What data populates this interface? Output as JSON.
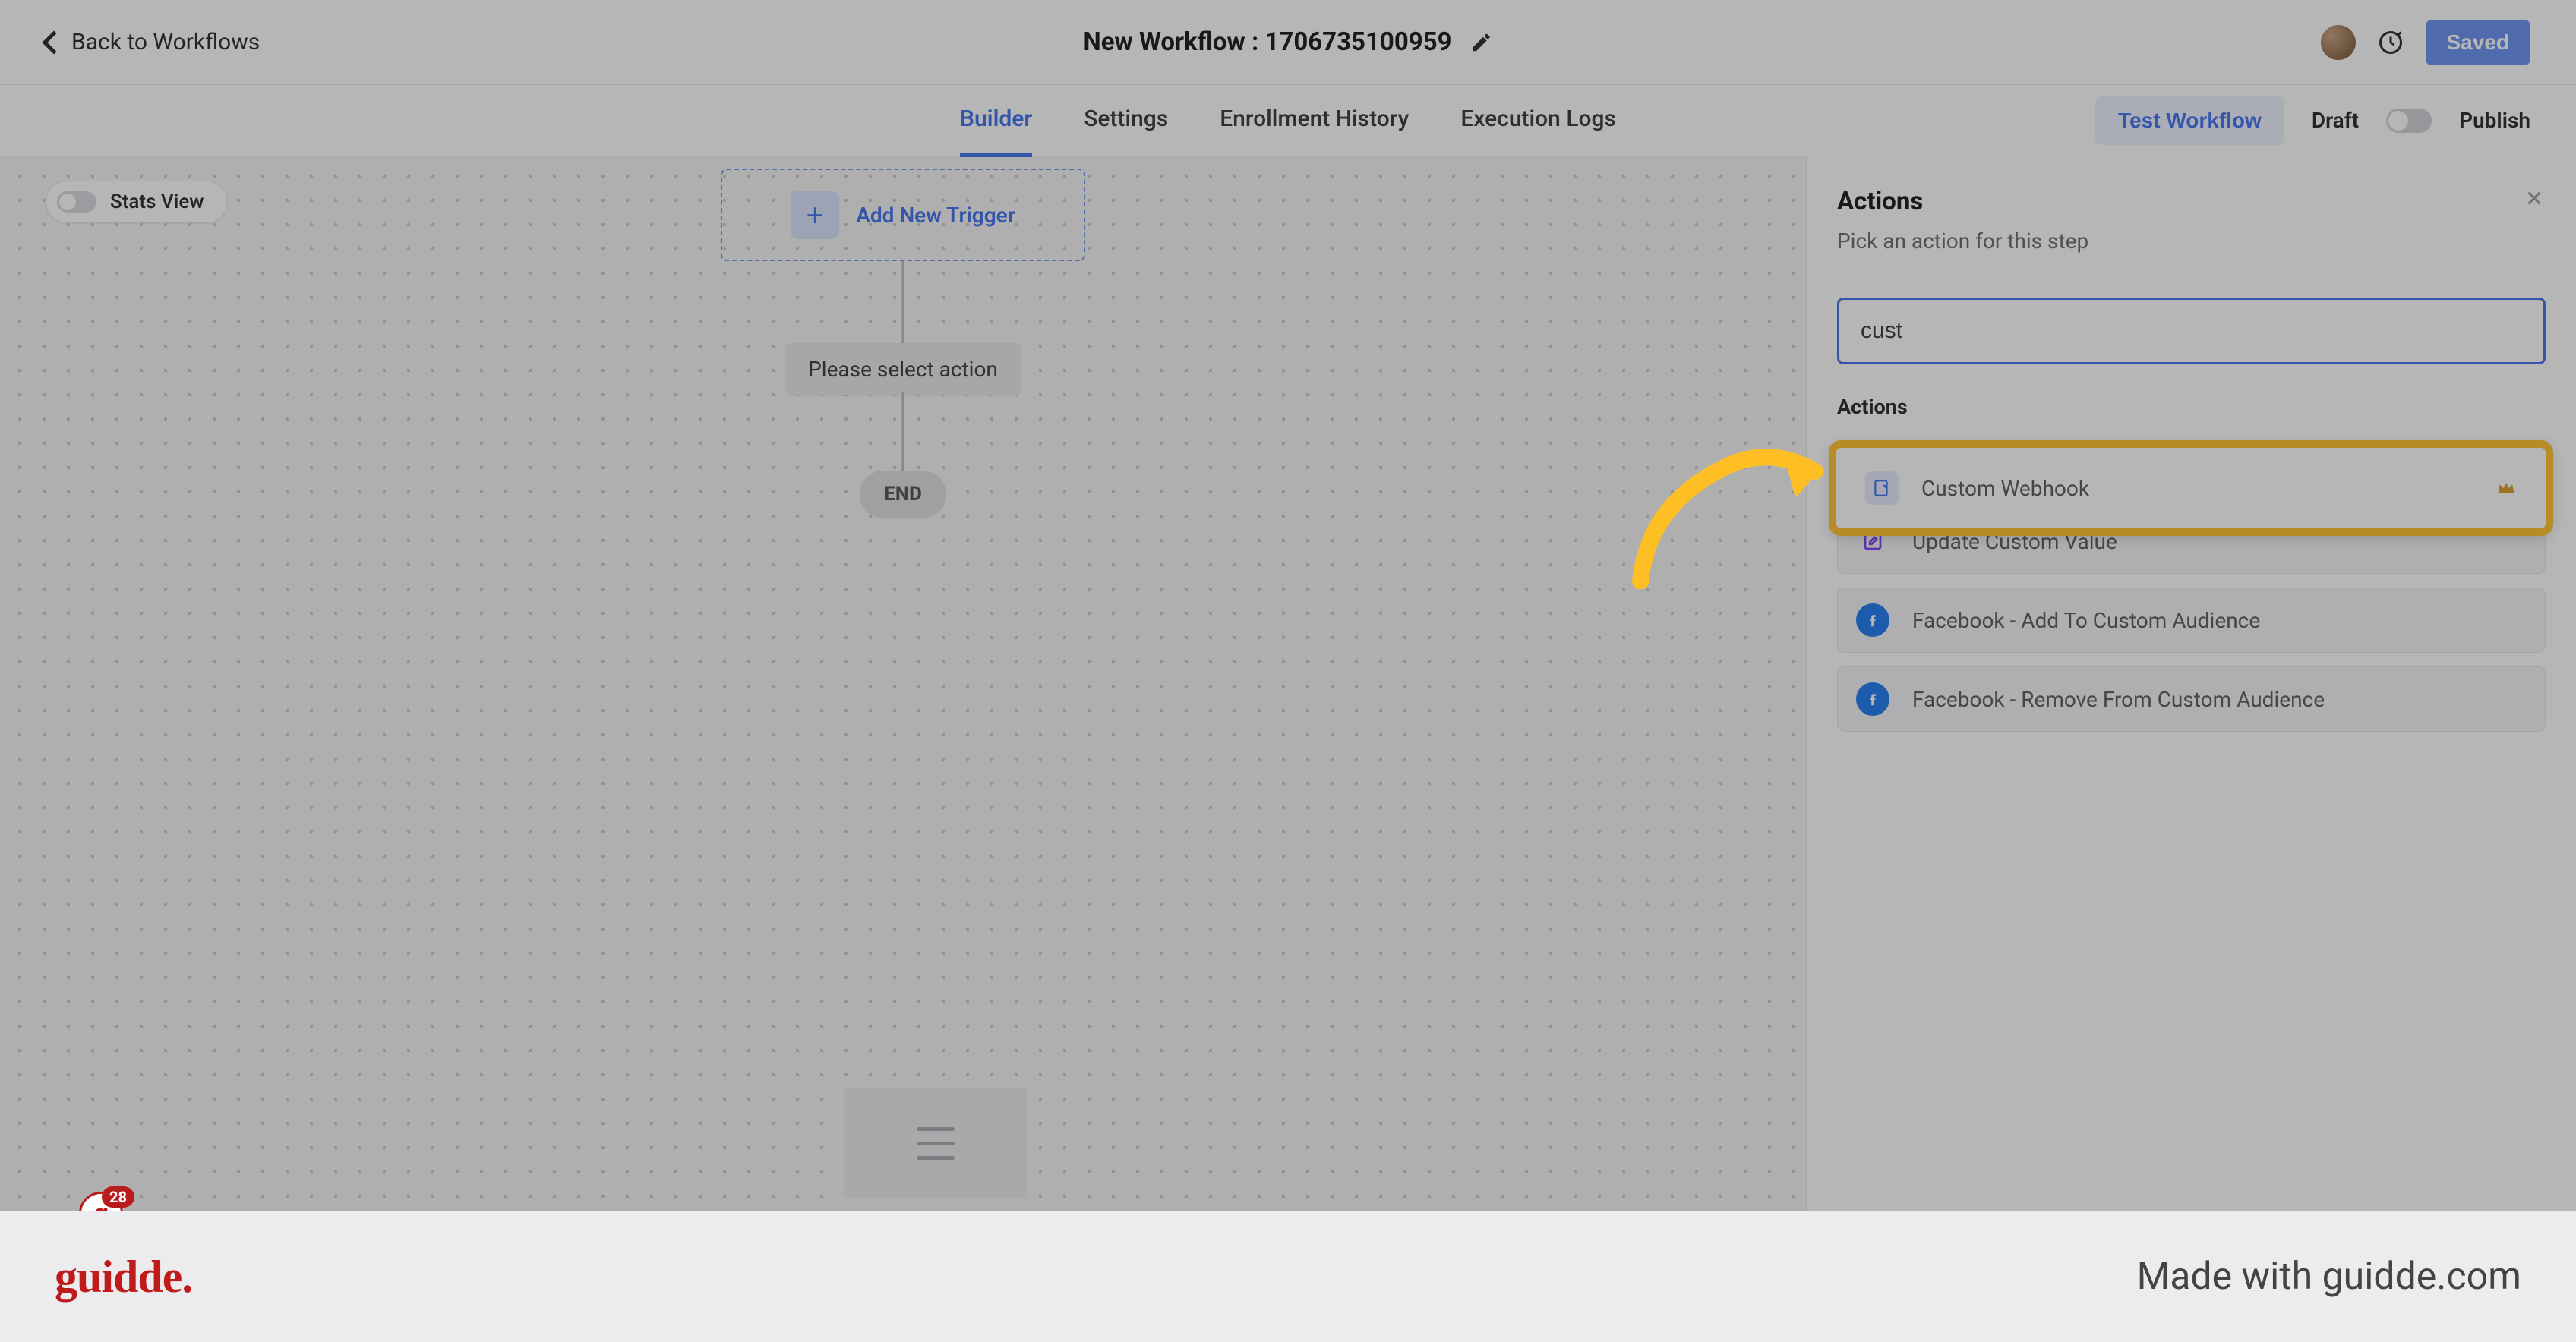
{
  "header": {
    "back_label": "Back to Workflows",
    "title": "New Workflow : 1706735100959",
    "saved_label": "Saved"
  },
  "tabs": {
    "items": [
      "Builder",
      "Settings",
      "Enrollment History",
      "Execution Logs"
    ],
    "test_label": "Test Workflow",
    "draft_label": "Draft",
    "publish_label": "Publish"
  },
  "canvas": {
    "stats_label": "Stats View",
    "trigger_label": "Add New Trigger",
    "action_placeholder": "Please select action",
    "end_label": "END"
  },
  "panel": {
    "title": "Actions",
    "subtitle": "Pick an action for this step",
    "search_value": "cust",
    "section_label": "Actions",
    "items": [
      {
        "label": "Custom Webhook",
        "icon": "webhook",
        "premium": true
      },
      {
        "label": "Update Custom Value",
        "icon": "update",
        "premium": false
      },
      {
        "label": "Facebook - Add To Custom Audience",
        "icon": "fb",
        "premium": false
      },
      {
        "label": "Facebook - Remove From Custom Audience",
        "icon": "fb",
        "premium": false
      }
    ]
  },
  "logo_badge": {
    "count": "28"
  },
  "footer": {
    "logo": "guidde.",
    "made_with": "Made with guidde.com"
  }
}
